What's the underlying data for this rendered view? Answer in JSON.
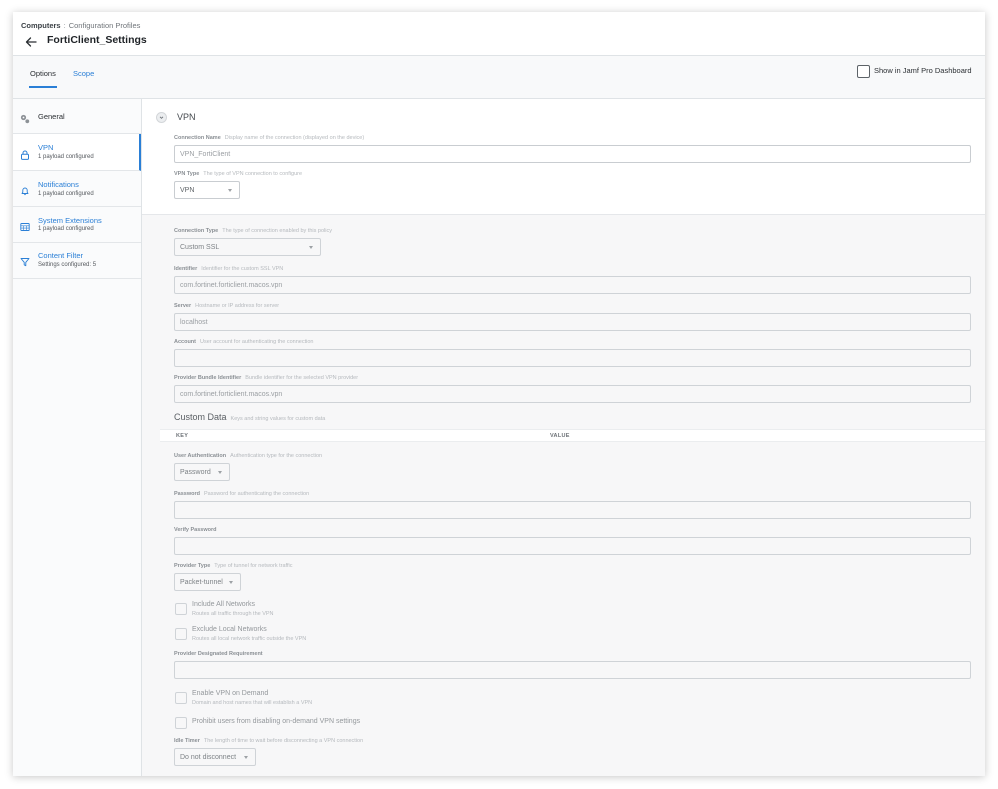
{
  "header": {
    "breadcrumb_root": "Computers",
    "breadcrumb_separator": ":",
    "breadcrumb_current": "Configuration Profiles",
    "title": "FortiClient_Settings"
  },
  "tabs": {
    "options": "Options",
    "scope": "Scope",
    "dashboard_label": "Show in Jamf Pro Dashboard"
  },
  "sidebar": {
    "items": [
      {
        "title": "General",
        "subtitle": ""
      },
      {
        "title": "VPN",
        "subtitle": "1 payload configured"
      },
      {
        "title": "Notifications",
        "subtitle": "1 payload configured"
      },
      {
        "title": "System Extensions",
        "subtitle": "1 payload configured"
      },
      {
        "title": "Content Filter",
        "subtitle": "Settings configured: 5"
      }
    ]
  },
  "vpn": {
    "section_title": "VPN",
    "connection_name": {
      "label": "Connection Name",
      "desc": "Display name of the connection (displayed on the device)",
      "value": "VPN_FortiClient"
    },
    "vpn_type": {
      "label": "VPN Type",
      "desc": "The type of VPN connection to configure",
      "value": "VPN"
    },
    "connection_type": {
      "label": "Connection Type",
      "desc": "The type of connection enabled by this policy",
      "value": "Custom SSL"
    },
    "identifier": {
      "label": "Identifier",
      "desc": "Identifier for the custom SSL VPN",
      "value": "com.fortinet.forticlient.macos.vpn"
    },
    "server": {
      "label": "Server",
      "desc": "Hostname or IP address for server",
      "value": "localhost"
    },
    "account": {
      "label": "Account",
      "desc": "User account for authenticating the connection",
      "value": ""
    },
    "provider_bundle": {
      "label": "Provider Bundle Identifier",
      "desc": "Bundle identifier for the selected VPN provider",
      "value": "com.fortinet.forticlient.macos.vpn"
    },
    "custom_data": {
      "title": "Custom Data",
      "desc": "Keys and string values for custom data",
      "key_header": "KEY",
      "value_header": "VALUE"
    },
    "user_auth": {
      "label": "User Authentication",
      "desc": "Authentication type for the connection",
      "value": "Password"
    },
    "password": {
      "label": "Password",
      "desc": "Password for authenticating the connection",
      "value": ""
    },
    "verify_password": {
      "label": "Verify Password",
      "value": ""
    },
    "provider_type": {
      "label": "Provider Type",
      "desc": "Type of tunnel for network traffic",
      "value": "Packet-tunnel"
    },
    "include_all": {
      "title": "Include All Networks",
      "sub": "Routes all traffic through the VPN"
    },
    "exclude_local": {
      "title": "Exclude Local Networks",
      "sub": "Routes all local network traffic outside the VPN"
    },
    "designated_req": {
      "label": "Provider Designated Requirement",
      "value": ""
    },
    "on_demand": {
      "title": "Enable VPN on Demand",
      "sub": "Domain and host names that will establish a VPN"
    },
    "prohibit": {
      "title": "Prohibit users from disabling on-demand VPN settings"
    },
    "idle_timer": {
      "label": "Idle Timer",
      "desc": "The length of time to wait before disconnecting a VPN connection",
      "value": "Do not disconnect"
    }
  },
  "colors": {
    "accent": "#2a7fd6",
    "text": "#2b2f33",
    "muted": "#b5b9bd"
  }
}
